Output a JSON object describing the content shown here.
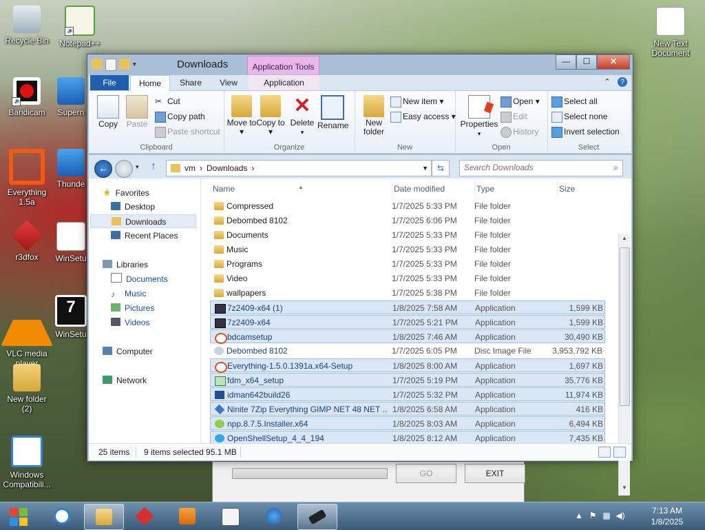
{
  "desktop": {
    "icons": [
      {
        "label": "Recycle Bin"
      },
      {
        "label": "Notepad++"
      },
      {
        "label": "Bandicam"
      },
      {
        "label": "Supern"
      },
      {
        "label": "Everything 1.5a"
      },
      {
        "label": "Thunde"
      },
      {
        "label": "r3dfox"
      },
      {
        "label": "WinSetu"
      },
      {
        "label": "VLC media player"
      },
      {
        "label": "WinSetu"
      },
      {
        "label": "New folder (2)"
      },
      {
        "label": "Windows Compatibili..."
      },
      {
        "label": "New Text Document"
      }
    ]
  },
  "background_dialog": {
    "go_label": "GO",
    "exit_label": "EXIT"
  },
  "window": {
    "title": "Downloads",
    "context_tab_header": "Application Tools",
    "caption": {
      "minimize": "—",
      "maximize": "☐",
      "close": "✕"
    },
    "tabs": [
      "File",
      "Home",
      "Share",
      "View",
      "Application"
    ],
    "ribbon": {
      "clipboard": {
        "label": "Clipboard",
        "copy": "Copy",
        "paste": "Paste",
        "cut": "Cut",
        "copy_path": "Copy path",
        "paste_shortcut": "Paste shortcut"
      },
      "organize": {
        "label": "Organize",
        "move_to": "Move to ▾",
        "copy_to": "Copy to ▾",
        "delete": "Delete",
        "delete_arrow": "▾",
        "rename": "Rename"
      },
      "new": {
        "label": "New",
        "new_folder": "New folder",
        "new_item": "New item ▾",
        "easy_access": "Easy access ▾"
      },
      "open": {
        "label": "Open",
        "properties": "Properties",
        "properties_arrow": "▾",
        "open": "Open ▾",
        "edit": "Edit",
        "history": "History"
      },
      "select": {
        "label": "Select",
        "select_all": "Select all",
        "select_none": "Select none",
        "invert_selection": "Invert selection"
      }
    },
    "address": {
      "crumbs": [
        "vm",
        "›",
        "Downloads",
        "›"
      ],
      "search_placeholder": "Search Downloads"
    },
    "nav": {
      "favorites": "Favorites",
      "desktop": "Desktop",
      "downloads": "Downloads",
      "recent_places": "Recent Places",
      "libraries": "Libraries",
      "documents": "Documents",
      "music": "Music",
      "pictures": "Pictures",
      "videos": "Videos",
      "computer": "Computer",
      "network": "Network"
    },
    "columns": {
      "name": "Name",
      "date": "Date modified",
      "type": "Type",
      "size": "Size"
    },
    "files": [
      {
        "name": "Compressed",
        "date": "1/7/2025 5:33 PM",
        "type": "File folder",
        "size": "",
        "icon": "folder",
        "selected": false
      },
      {
        "name": "Debombed 8102",
        "date": "1/7/2025 6:06 PM",
        "type": "File folder",
        "size": "",
        "icon": "folder",
        "selected": false
      },
      {
        "name": "Documents",
        "date": "1/7/2025 5:33 PM",
        "type": "File folder",
        "size": "",
        "icon": "folder",
        "selected": false
      },
      {
        "name": "Music",
        "date": "1/7/2025 5:33 PM",
        "type": "File folder",
        "size": "",
        "icon": "folder",
        "selected": false
      },
      {
        "name": "Programs",
        "date": "1/7/2025 5:33 PM",
        "type": "File folder",
        "size": "",
        "icon": "folder",
        "selected": false
      },
      {
        "name": "Video",
        "date": "1/7/2025 5:33 PM",
        "type": "File folder",
        "size": "",
        "icon": "folder",
        "selected": false
      },
      {
        "name": "wallpapers",
        "date": "1/7/2025 5:38 PM",
        "type": "File folder",
        "size": "",
        "icon": "folder",
        "selected": false
      },
      {
        "name": "7z2409-x64 (1)",
        "date": "1/8/2025 7:58 AM",
        "type": "Application",
        "size": "1,599 KB",
        "icon": "app",
        "selected": true
      },
      {
        "name": "7z2409-x64",
        "date": "1/7/2025 5:21 PM",
        "type": "Application",
        "size": "1,599 KB",
        "icon": "app",
        "selected": true
      },
      {
        "name": "bdcamsetup",
        "date": "1/8/2025 7:46 AM",
        "type": "Application",
        "size": "30,490 KB",
        "icon": "red",
        "selected": true
      },
      {
        "name": "Debombed 8102",
        "date": "1/7/2025 6:05 PM",
        "type": "Disc Image File",
        "size": "3,953,792 KB",
        "icon": "iso",
        "selected": false
      },
      {
        "name": "Everything-1.5.0.1391a.x64-Setup",
        "date": "1/8/2025 8:00 AM",
        "type": "Application",
        "size": "1,697 KB",
        "icon": "red",
        "selected": true
      },
      {
        "name": "fdm_x64_setup",
        "date": "1/7/2025 5:19 PM",
        "type": "Application",
        "size": "35,776 KB",
        "icon": "dl",
        "selected": true
      },
      {
        "name": "idman642build26",
        "date": "1/7/2025 5:32 PM",
        "type": "Application",
        "size": "11,974 KB",
        "icon": "idm",
        "selected": true
      },
      {
        "name": "Ninite 7Zip Everything GIMP NET 48 NET ...",
        "date": "1/8/2025 6:58 AM",
        "type": "Application",
        "size": "416 KB",
        "icon": "ninite",
        "selected": true
      },
      {
        "name": "npp.8.7.5.Installer.x64",
        "date": "1/8/2025 8:03 AM",
        "type": "Application",
        "size": "6,494 KB",
        "icon": "npp",
        "selected": true
      },
      {
        "name": "OpenShellSetup_4_4_194",
        "date": "1/8/2025 8:12 AM",
        "type": "Application",
        "size": "7,435 KB",
        "icon": "shell",
        "selected": true
      }
    ],
    "status": {
      "items": "25 items",
      "selected": "9 items selected  95.1 MB"
    }
  },
  "taskbar": {
    "clock_time": "7:13 AM",
    "clock_date": "1/8/2025"
  }
}
